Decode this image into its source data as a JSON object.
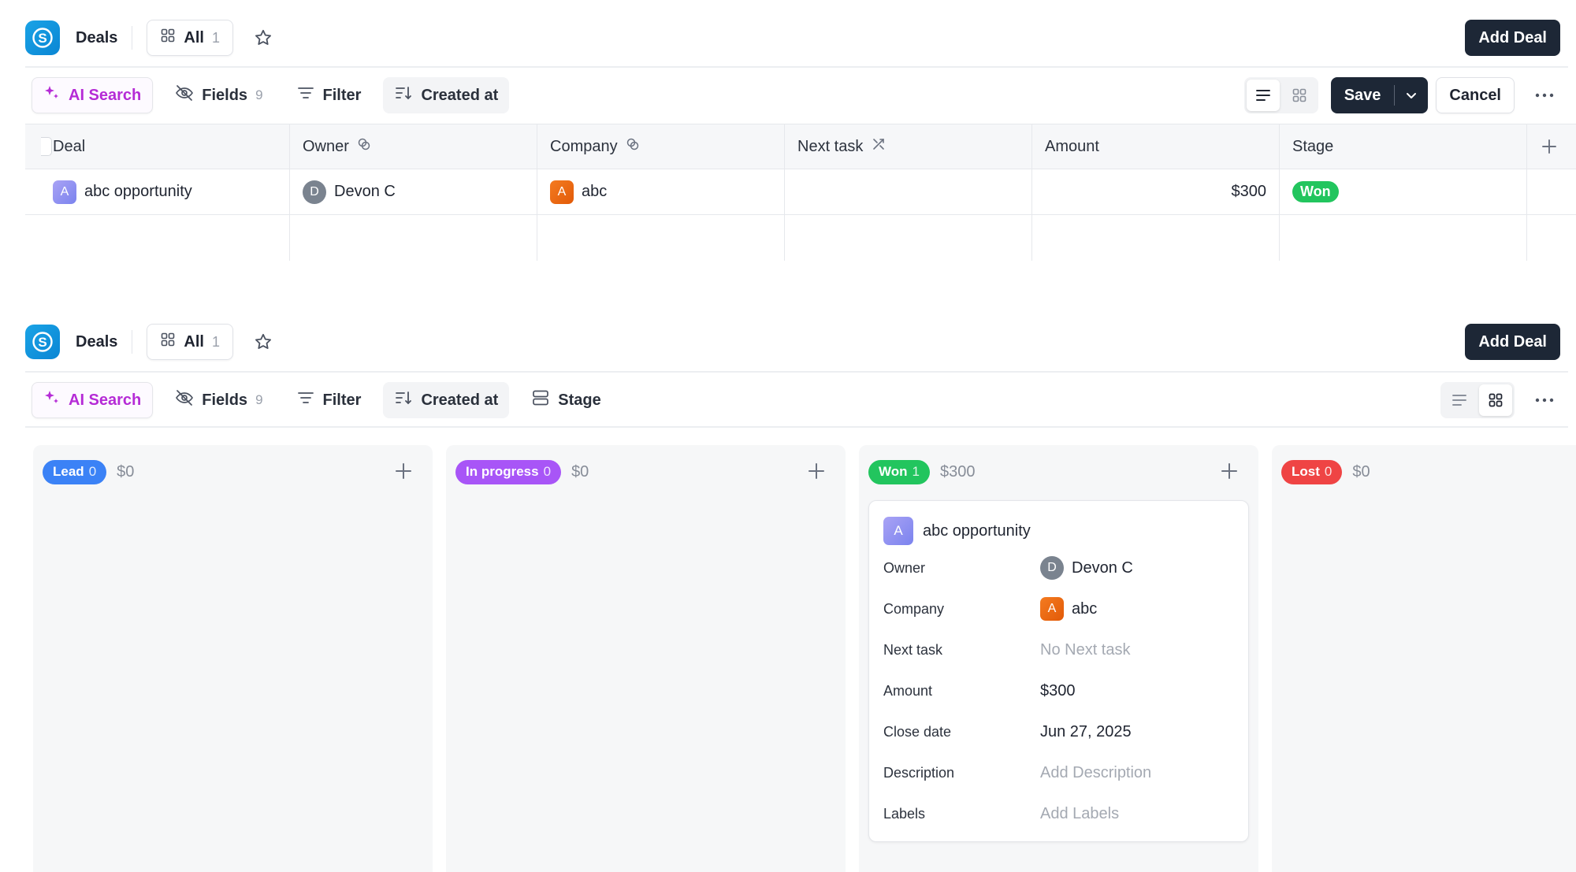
{
  "top": {
    "breadcrumb": "Deals",
    "view": {
      "label": "All",
      "count": "1"
    },
    "add_button": "Add Deal"
  },
  "toolbar_list": {
    "ai_search": "AI Search",
    "fields": {
      "label": "Fields",
      "count": "9"
    },
    "filter": "Filter",
    "sort": "Created at",
    "save": "Save",
    "cancel": "Cancel"
  },
  "table": {
    "columns": [
      "Deal",
      "Owner",
      "Company",
      "Next task",
      "Amount",
      "Stage"
    ],
    "rows": [
      {
        "deal": "abc opportunity",
        "deal_initial": "A",
        "owner": "Devon C",
        "owner_initial": "D",
        "company": "abc",
        "company_initial": "A",
        "next_task": "",
        "amount": "$300",
        "stage": "Won"
      }
    ]
  },
  "bottom": {
    "breadcrumb": "Deals",
    "view": {
      "label": "All",
      "count": "1"
    },
    "add_button": "Add Deal"
  },
  "toolbar_board": {
    "ai_search": "AI Search",
    "fields": {
      "label": "Fields",
      "count": "9"
    },
    "filter": "Filter",
    "sort": "Created at",
    "group": "Stage"
  },
  "board": {
    "columns": [
      {
        "name": "Lead",
        "count": "0",
        "sum": "$0",
        "color": "#3b82f6"
      },
      {
        "name": "In progress",
        "count": "0",
        "sum": "$0",
        "color": "#a855f7"
      },
      {
        "name": "Won",
        "count": "1",
        "sum": "$300",
        "color": "#22c55e"
      },
      {
        "name": "Lost",
        "count": "0",
        "sum": "$0",
        "color": "#ef4444"
      }
    ],
    "card": {
      "title": "abc opportunity",
      "title_initial": "A",
      "fields": [
        {
          "label": "Owner",
          "value": "Devon C",
          "initial": "D"
        },
        {
          "label": "Company",
          "value": "abc",
          "initial": "A"
        },
        {
          "label": "Next task",
          "value": "No Next task"
        },
        {
          "label": "Amount",
          "value": "$300"
        },
        {
          "label": "Close date",
          "value": "Jun 27, 2025"
        },
        {
          "label": "Description",
          "value": "Add Description"
        },
        {
          "label": "Labels",
          "value": "Add Labels"
        }
      ]
    }
  },
  "colors": {
    "accent_dark": "#1d2736",
    "logo": "#0a86d4",
    "ai": "#b52bd6",
    "won": "#22c55e"
  }
}
